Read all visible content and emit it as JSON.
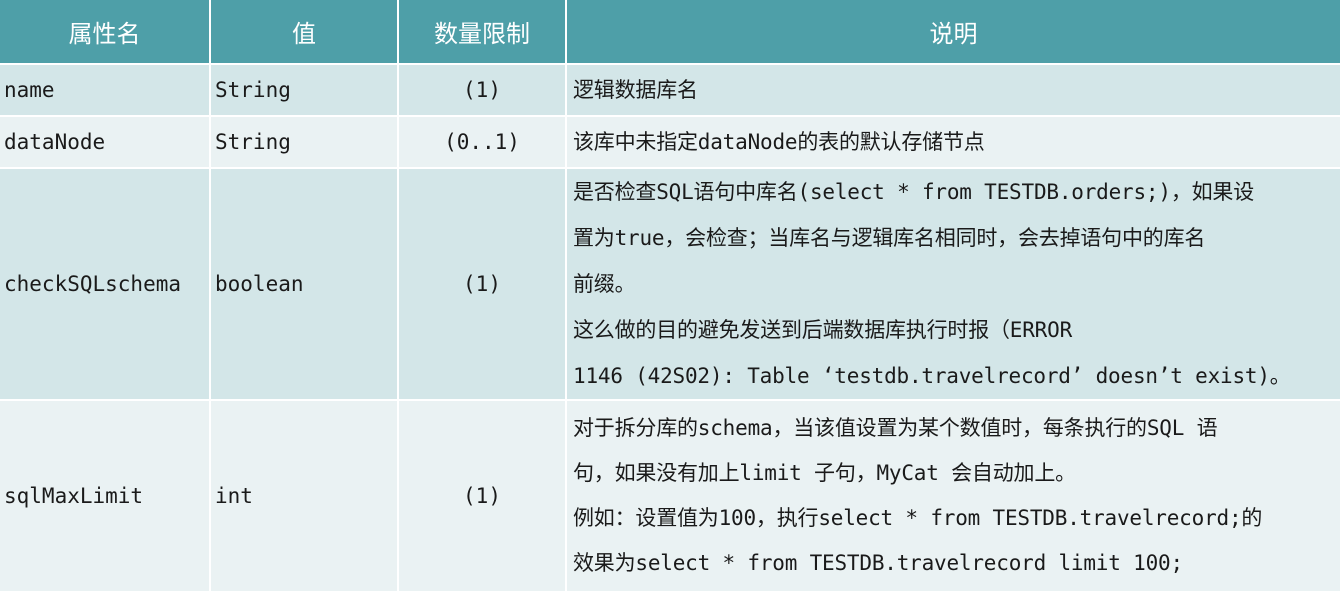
{
  "headers": {
    "name": "属性名",
    "value": "值",
    "limit": "数量限制",
    "desc": "说明"
  },
  "rows": [
    {
      "name": "name",
      "type": "String",
      "limit": "(1)",
      "desc": [
        "逻辑数据库名"
      ]
    },
    {
      "name": "dataNode",
      "type": "String",
      "limit": "(0..1)",
      "desc": [
        "该库中未指定dataNode的表的默认存储节点"
      ]
    },
    {
      "name": "checkSQLschema",
      "type": "boolean",
      "limit": "(1)",
      "desc": [
        "是否检查SQL语句中库名(select * from TESTDB.orders;)，如果设",
        "置为true，会检查；当库名与逻辑库名相同时，会去掉语句中的库名",
        "前缀。",
        "这么做的目的避免发送到后端数据库执行时报（ERROR",
        "1146 (42S02): Table ‘testdb.travelrecord’ doesn’t exist)。"
      ]
    },
    {
      "name": "sqlMaxLimit",
      "type": "int",
      "limit": "(1)",
      "desc": [
        "对于拆分库的schema，当该值设置为某个数值时，每条执行的SQL 语",
        "句，如果没有加上limit 子句，MyCat 会自动加上。",
        "例如：设置值为100，执行select * from TESTDB.travelrecord;的",
        "效果为select * from TESTDB.travelrecord limit 100;"
      ]
    }
  ]
}
